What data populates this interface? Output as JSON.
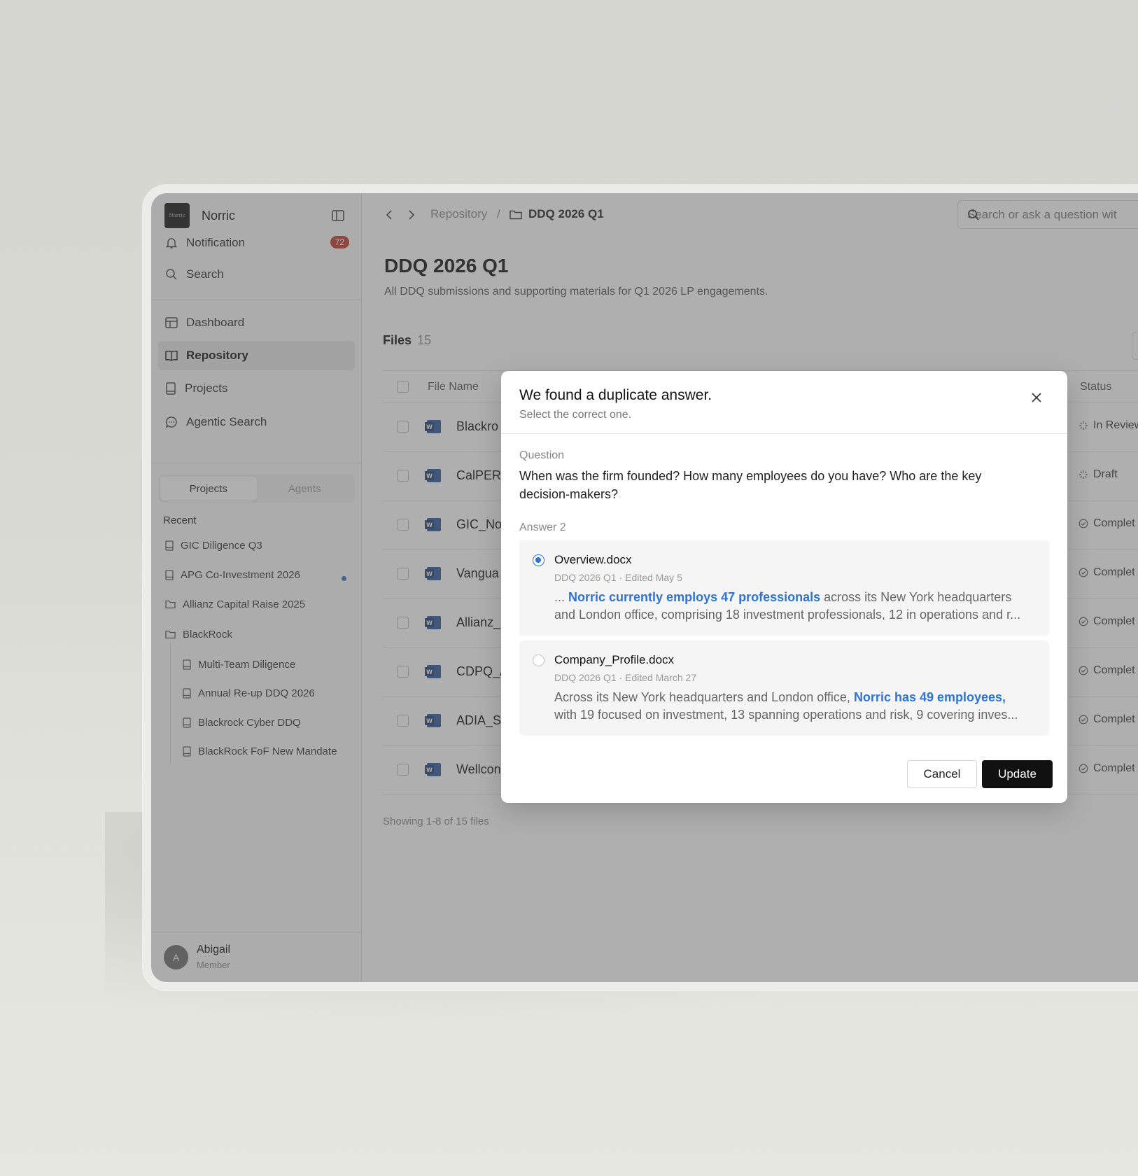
{
  "brand": {
    "logo_text": "Norric",
    "name": "Norric"
  },
  "nav": {
    "notification": {
      "label": "Notification",
      "badge": "72"
    },
    "search": "Search",
    "dashboard": "Dashboard",
    "repository": "Repository",
    "projects": "Projects",
    "agentic_search": "Agentic Search"
  },
  "segmented": {
    "projects": "Projects",
    "agents": "Agents"
  },
  "recent": {
    "label": "Recent",
    "items": [
      "GIC Diligence Q3",
      "APG Co-Investment 2026",
      "Allianz Capital Raise 2025",
      "BlackRock",
      "Multi-Team Diligence",
      "Annual Re-up DDQ 2026",
      "Blackrock Cyber DDQ",
      "BlackRock FoF New Mandate"
    ]
  },
  "user": {
    "initial": "A",
    "name": "Abigail",
    "role": "Member"
  },
  "breadcrumb": {
    "parent": "Repository",
    "separator": "/",
    "current": "DDQ 2026 Q1"
  },
  "search": {
    "placeholder": "Search or ask a question wit"
  },
  "page": {
    "title": "DDQ 2026 Q1",
    "subtitle": "All DDQ submissions and supporting materials for Q1 2026 LP engagements.",
    "files_label": "Files",
    "files_count": "15",
    "showing": "Showing 1-8 of 15 files"
  },
  "table": {
    "headers": {
      "file_name": "File Name",
      "status": "Status"
    },
    "rows": [
      {
        "name": "Blackro",
        "status": "In Review"
      },
      {
        "name": "CalPERS",
        "status": "Draft"
      },
      {
        "name": "GIC_No",
        "status": "Complet"
      },
      {
        "name": "Vangua",
        "status": "Complet"
      },
      {
        "name": "Allianz_",
        "status": "Complet"
      },
      {
        "name": "CDPQ_A",
        "status": "Complet"
      },
      {
        "name": "ADIA_Sc",
        "status": "Complet"
      },
      {
        "name": "Wellcon",
        "status": "Complet"
      }
    ]
  },
  "modal": {
    "title": "We found a duplicate answer.",
    "subtitle": "Select the correct one.",
    "question_label": "Question",
    "question": "When was the firm founded? How many employees do you have? Who are the key decision-makers?",
    "answer_label": "Answer 2",
    "options": [
      {
        "file": "Overview.docx",
        "meta": "DDQ 2026 Q1 · Edited May 5",
        "prefix": "... ",
        "highlight": "Norric currently employs 47 professionals",
        "suffix": " across its New York headquarters",
        "line2": "and London office, comprising 18 investment professionals, 12 in operations and r...",
        "selected": true
      },
      {
        "file": "Company_Profile.docx",
        "meta": "DDQ 2026 Q1 · Edited March 27",
        "prefix": "Across its New York headquarters and London office, ",
        "highlight": "Norric has 49 employees,",
        "suffix": "",
        "line2": "with 19 focused on investment, 13 spanning operations and risk, 9 covering inves...",
        "selected": false
      }
    ],
    "cancel": "Cancel",
    "update": "Update"
  },
  "colors": {
    "accent": "#2f74d0",
    "badge": "#c0392b",
    "primary_button": "#111111"
  }
}
